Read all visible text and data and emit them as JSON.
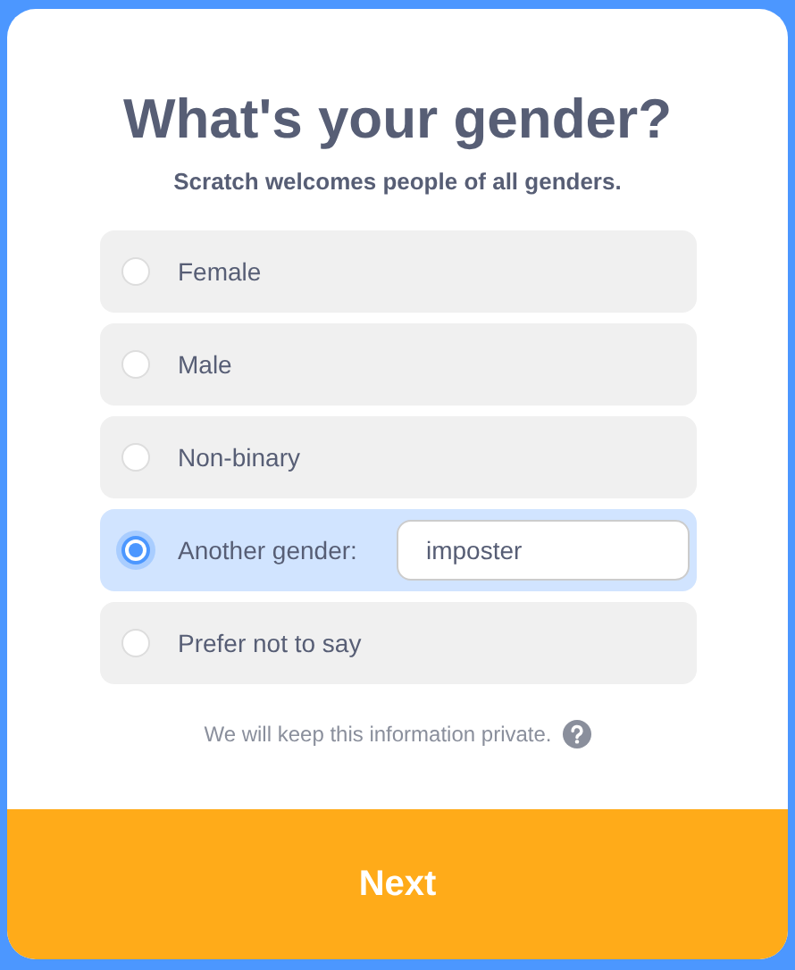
{
  "title": "What's your gender?",
  "subtitle": "Scratch welcomes people of all genders.",
  "options": [
    {
      "label": "Female",
      "kind": "plain",
      "selected": false
    },
    {
      "label": "Male",
      "kind": "plain",
      "selected": false
    },
    {
      "label": "Non-binary",
      "kind": "plain",
      "selected": false
    },
    {
      "label": "Another gender:",
      "kind": "text_entry",
      "value": "imposter",
      "selected": true
    },
    {
      "label": "Prefer not to say",
      "kind": "plain",
      "selected": false
    }
  ],
  "privacy_note": "We will keep this information private.",
  "next_button": "Next"
}
